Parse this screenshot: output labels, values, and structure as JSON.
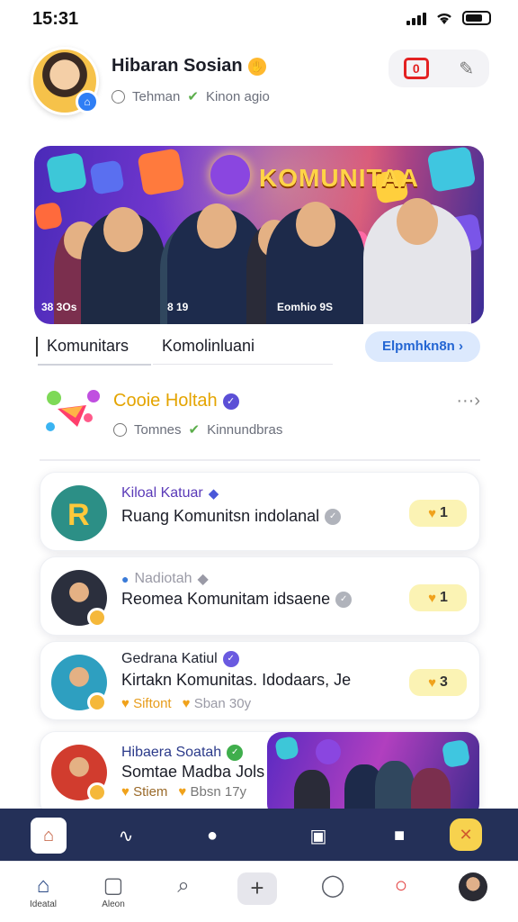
{
  "status_bar": {
    "time": "15:31"
  },
  "header": {
    "title": "Hibaran Sosian",
    "meta_a": "Tehman",
    "meta_b": "Kinon agio"
  },
  "banner": {
    "title": "KOMUNITAA",
    "caption_left": "38 3Os",
    "caption_mid": "8 19",
    "caption_right": "Eomhio 9S"
  },
  "tabs": [
    {
      "label": "Komunitars"
    },
    {
      "label": "Komolinluani"
    }
  ],
  "explore_button": "Elpmhkn8n",
  "featured": {
    "title": "Cooie Holtah",
    "meta_a": "Tomnes",
    "meta_b": "Kinnundbras"
  },
  "cards": [
    {
      "name": "Kiloal Katuar",
      "line": "Ruang Komunitsn indolanal",
      "count": "1",
      "name_color": "#5a3ab8"
    },
    {
      "name": "Nadiotah",
      "line": "Reomea Komunitam idsaene",
      "count": "1",
      "name_color": "#9a9aa6"
    },
    {
      "name": "Gedrana Katiul",
      "line": "Kirtakn Komunitas. Idodaars, Je",
      "meta_a": "Siftont",
      "meta_b": "Sban 30y",
      "count": "3",
      "name_color": "#1b1d27"
    },
    {
      "name": "Hibaera Soatah",
      "line": "Somtae Madba Jols",
      "meta_a": "Stiem",
      "meta_b": "Bbsn 17y",
      "name_color": "#2b3a8a"
    }
  ],
  "tabbar": {
    "home_label": "Ideatal",
    "second_label": "Aleon"
  }
}
